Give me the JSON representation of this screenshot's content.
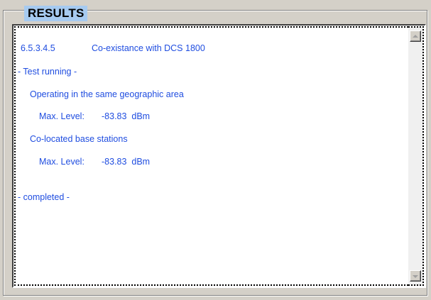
{
  "results": {
    "title": "RESULTS",
    "lines": [
      {
        "col1": "6.5.3.4.5",
        "col2": "Co-existance with DCS 1800"
      },
      {
        "text": "- Test running -"
      },
      {
        "text": "Operating in the same geographic area"
      },
      {
        "col1": "Max. Level:",
        "col2": "-83.83  dBm"
      },
      {
        "text": "Co-located base stations"
      },
      {
        "col1": "Max. Level:",
        "col2": "-83.83  dBm"
      },
      {
        "text": "- completed -"
      }
    ]
  },
  "colors": {
    "text": "#1f4de0",
    "title_bg": "#a6caf0",
    "window_bg": "#d4d0c8"
  },
  "icons": {
    "scroll_up": "arrow-up-icon",
    "scroll_down": "arrow-down-icon"
  }
}
